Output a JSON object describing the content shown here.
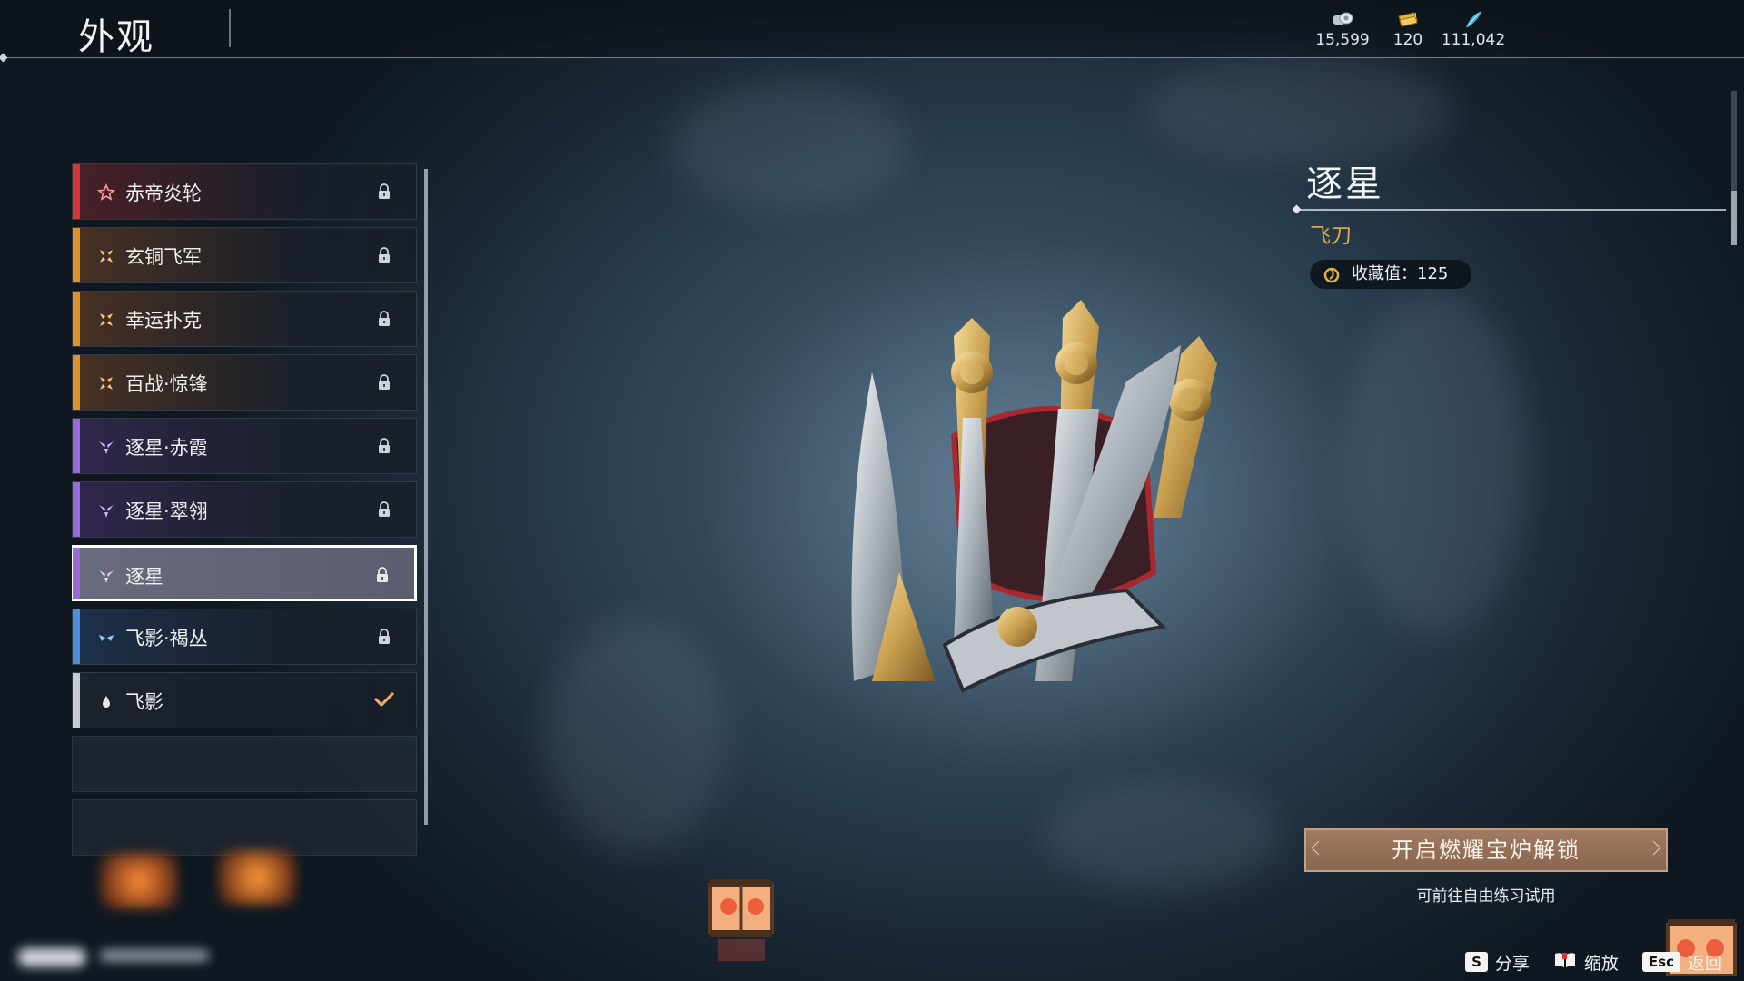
{
  "header": {
    "title": "外观",
    "currencies": [
      {
        "icon": "coin-pile-icon",
        "value": "15,599"
      },
      {
        "icon": "gold-ticket-icon",
        "value": "120"
      },
      {
        "icon": "blue-feather-icon",
        "value": "111,042"
      }
    ]
  },
  "list": {
    "items": [
      {
        "label": "赤帝炎轮",
        "rarity_color": "#d0363a",
        "icon": "star-outline-icon",
        "state": "locked"
      },
      {
        "label": "玄铜飞军",
        "rarity_color": "#e0902e",
        "icon": "four-petal-icon",
        "state": "locked"
      },
      {
        "label": "幸运扑克",
        "rarity_color": "#e0902e",
        "icon": "four-petal-icon",
        "state": "locked"
      },
      {
        "label": "百战·惊锋",
        "rarity_color": "#e0902e",
        "icon": "four-petal-icon",
        "state": "locked"
      },
      {
        "label": "逐星·赤霞",
        "rarity_color": "#9b6ad8",
        "icon": "three-petal-icon",
        "state": "locked"
      },
      {
        "label": "逐星·翠翎",
        "rarity_color": "#9b6ad8",
        "icon": "three-petal-icon",
        "state": "locked"
      },
      {
        "label": "逐星",
        "rarity_color": "#9b6ad8",
        "icon": "three-petal-icon",
        "state": "locked",
        "selected": true
      },
      {
        "label": "飞影·褐丛",
        "rarity_color": "#4a90d8",
        "icon": "two-petal-icon",
        "state": "locked"
      },
      {
        "label": "飞影",
        "rarity_color": "#c8ccd2",
        "icon": "droplet-icon",
        "state": "equipped"
      }
    ]
  },
  "detail": {
    "name": "逐星",
    "type": "飞刀",
    "collection_label": "收藏值：125",
    "unlock_button": "开启燃耀宝炉解锁",
    "hint": "可前往自由练习试用"
  },
  "controls": [
    {
      "key": "S",
      "label": "分享"
    },
    {
      "key": "book-icon",
      "label": "缩放"
    },
    {
      "key": "Esc",
      "label": "返回"
    }
  ],
  "colors": {
    "accent_gold": "#d8a84a",
    "button_brown": "#9a745c"
  }
}
